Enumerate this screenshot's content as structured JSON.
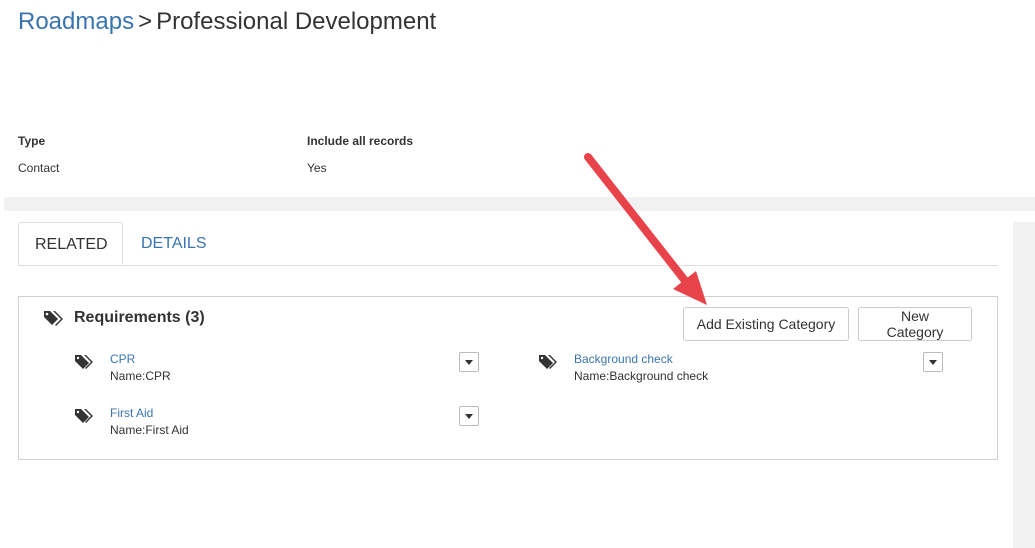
{
  "breadcrumb": {
    "parent": "Roadmaps",
    "separator": ">",
    "current": "Professional Development"
  },
  "fields": [
    {
      "label": "Type",
      "value": "Contact"
    },
    {
      "label": "Include all records",
      "value": "Yes"
    }
  ],
  "tabs": [
    {
      "label": "RELATED",
      "active": true
    },
    {
      "label": "DETAILS",
      "active": false
    }
  ],
  "requirements": {
    "title": "Requirements (3)",
    "add_existing_label": "Add Existing Category",
    "new_category_label": "New Category",
    "items": [
      {
        "link": "CPR",
        "name": "Name:CPR"
      },
      {
        "link": "Background check",
        "name": "Name:Background check"
      },
      {
        "link": "First Aid",
        "name": "Name:First Aid"
      }
    ]
  },
  "colors": {
    "link": "#3a75b0",
    "annotation_arrow": "#e8434a"
  },
  "icons": {
    "section": "tags-icon",
    "item": "tag-icon",
    "menu": "caret-down-icon"
  }
}
